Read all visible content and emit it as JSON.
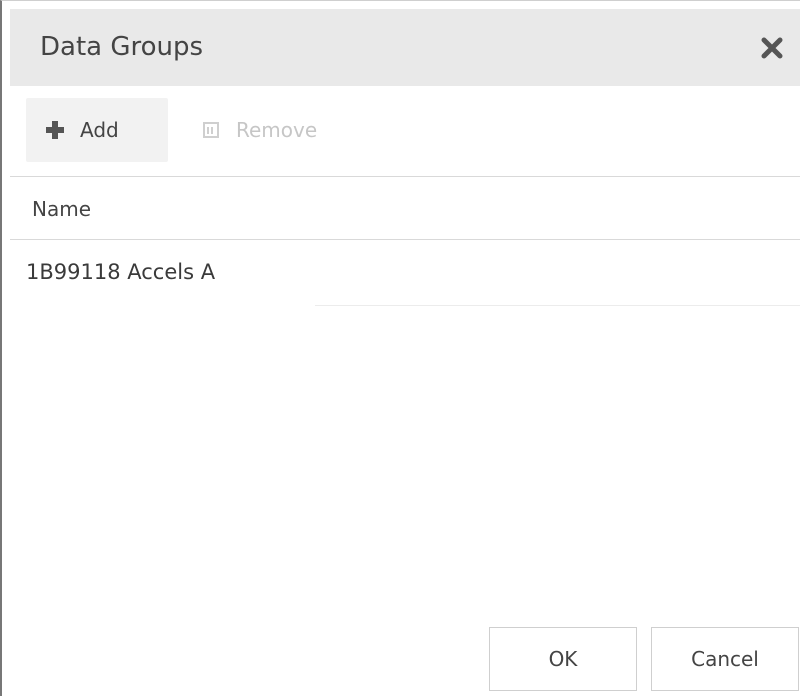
{
  "dialog": {
    "title": "Data Groups",
    "close_icon": "close-icon"
  },
  "toolbar": {
    "add_label": "Add",
    "add_icon": "plus-icon",
    "remove_label": "Remove",
    "remove_icon": "trash-icon",
    "remove_enabled": false
  },
  "list": {
    "columns": [
      "Name"
    ],
    "rows": [
      {
        "name": "1B99118 Accels A"
      }
    ]
  },
  "footer": {
    "ok_label": "OK",
    "cancel_label": "Cancel"
  }
}
